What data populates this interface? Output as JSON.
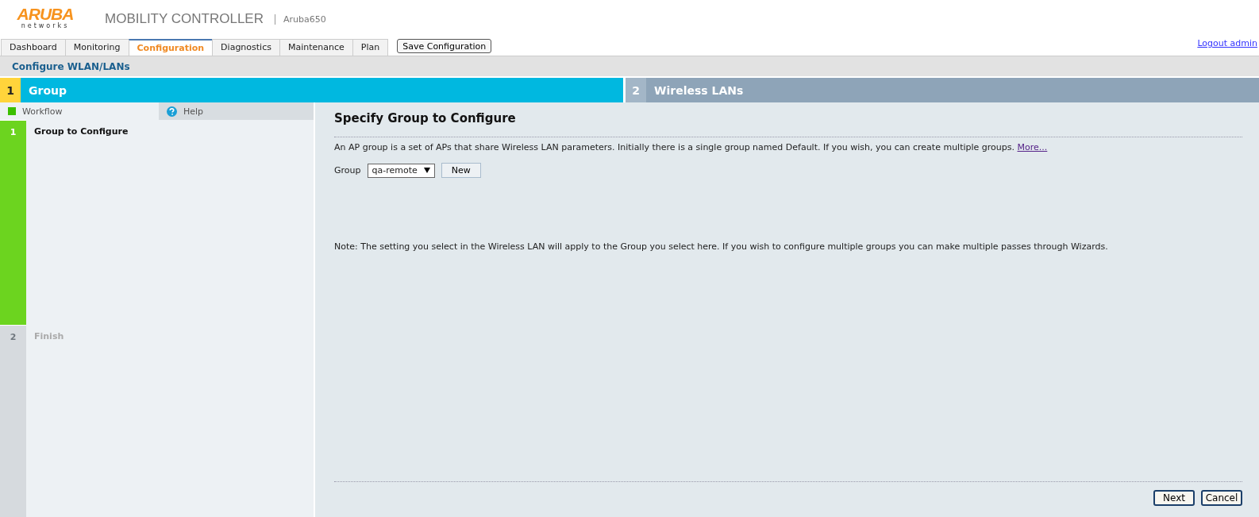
{
  "header": {
    "logo_word": "ARUBA",
    "logo_sub": "networks",
    "product": "MOBILITY CONTROLLER",
    "device": "Aruba650"
  },
  "tabs": [
    {
      "label": "Dashboard",
      "selected": false
    },
    {
      "label": "Monitoring",
      "selected": false
    },
    {
      "label": "Configuration",
      "selected": true
    },
    {
      "label": "Diagnostics",
      "selected": false
    },
    {
      "label": "Maintenance",
      "selected": false
    },
    {
      "label": "Plan",
      "selected": false
    }
  ],
  "save_button": "Save Configuration",
  "logout": "Logout admin",
  "breadcrumb": "Configure WLAN/LANs",
  "stages": [
    {
      "number": "1",
      "label": "Group",
      "selected": true
    },
    {
      "number": "2",
      "label": "Wireless LANs",
      "selected": false
    }
  ],
  "sidebar": {
    "workflow_label": "Workflow",
    "help_label": "Help",
    "steps": [
      {
        "number": "1",
        "label": "Group to Configure",
        "selected": true
      },
      {
        "number": "2",
        "label": "Finish",
        "selected": false
      }
    ]
  },
  "content": {
    "title": "Specify Group to Configure",
    "description": "An AP group is a set of APs that share Wireless LAN parameters. Initially there is a single group named Default. If you wish, you can create multiple groups.",
    "more_link": "More...",
    "group_label": "Group",
    "group_value": "qa-remote",
    "new_button": "New",
    "note": "Note: The setting you select in the Wireless LAN will apply to the Group you select here. If you wish to configure multiple groups you can make multiple passes through Wizards."
  },
  "footer_buttons": [
    "Next",
    "Cancel"
  ]
}
